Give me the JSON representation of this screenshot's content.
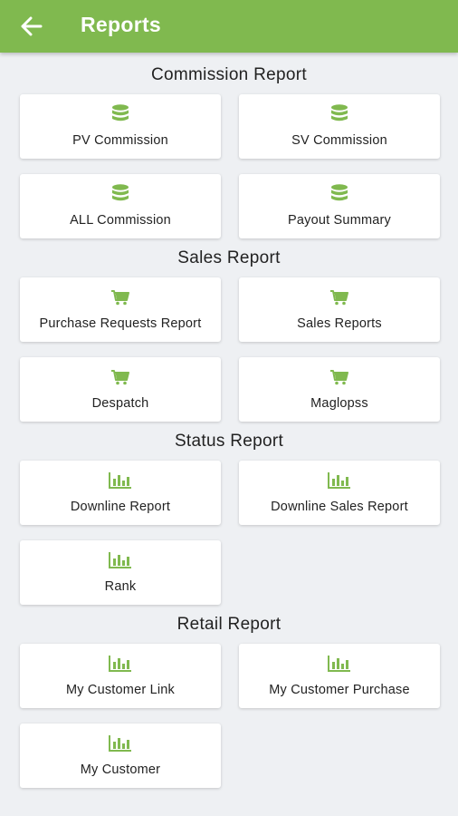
{
  "header": {
    "title": "Reports",
    "back_icon": "arrow-left-icon"
  },
  "colors": {
    "accent": "#80b94f",
    "background": "#eef0f3",
    "card": "#ffffff"
  },
  "sections": {
    "commission": {
      "title": "Commission Report",
      "icon": "database-icon",
      "items": [
        "PV Commission",
        "SV Commission",
        "ALL Commission",
        "Payout Summary"
      ]
    },
    "sales": {
      "title": "Sales Report",
      "icon": "cart-icon",
      "items": [
        "Purchase Requests Report",
        "Sales Reports",
        "Despatch",
        "Maglopss"
      ]
    },
    "status": {
      "title": "Status Report",
      "icon": "bar-chart-icon",
      "items": [
        "Downline Report",
        "Downline Sales Report",
        "Rank"
      ]
    },
    "retail": {
      "title": "Retail Report",
      "icon": "bar-chart-icon",
      "items": [
        "My Customer Link",
        "My Customer Purchase",
        "My Customer"
      ]
    }
  }
}
